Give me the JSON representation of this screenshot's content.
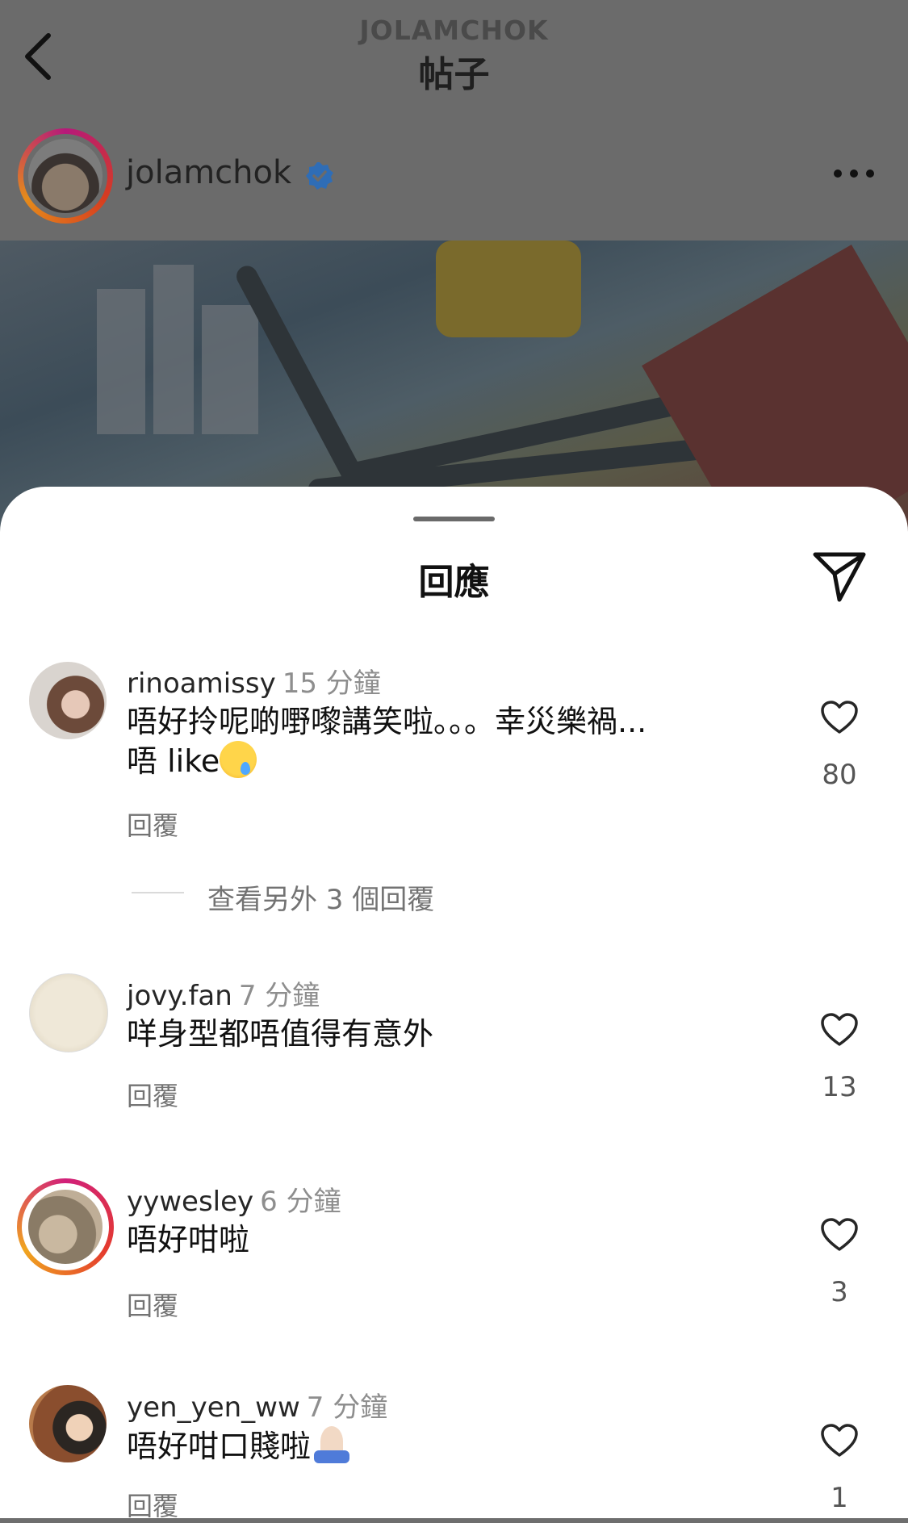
{
  "header": {
    "subtitle": "JOLAMCHOK",
    "title": "帖子"
  },
  "post": {
    "author": "jolamchok"
  },
  "sheet": {
    "title": "回應"
  },
  "comments": [
    {
      "username": "rinoamissy",
      "time": "15 分鐘",
      "text_line1": "唔好拎呢啲嘢嚟講笑啦。。。幸災樂禍...",
      "text_line2": "唔 like",
      "emoji": "crying-face",
      "reply": "回覆",
      "likes": "80",
      "view_more": "查看另外 3 個回覆"
    },
    {
      "username": "jovy.fan",
      "time": "7 分鐘",
      "text_line1": "咩身型都唔值得有意外",
      "reply": "回覆",
      "likes": "13"
    },
    {
      "username": "yywesley",
      "time": "6 分鐘",
      "text_line1": "唔好咁啦",
      "reply": "回覆",
      "likes": "3"
    },
    {
      "username": "yen_yen_ww",
      "time": "7 分鐘",
      "text_line1": "唔好咁口賤啦",
      "emoji": "folded-hands",
      "reply": "回覆",
      "likes": "1"
    }
  ],
  "colors": {
    "dim_overlay": "#6b6b6b",
    "sheet_bg": "#ffffff",
    "verified": "#3b7fd6",
    "story_ring": "#d1207a"
  }
}
